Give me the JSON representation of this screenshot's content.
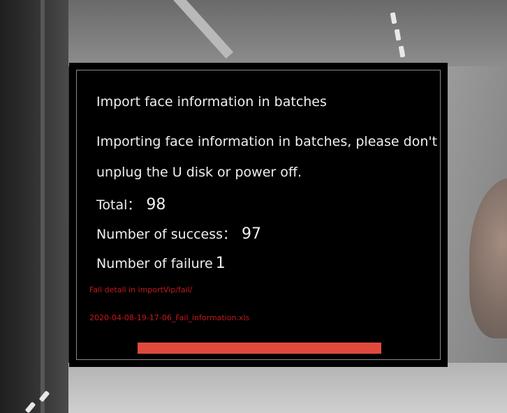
{
  "dialog": {
    "title": "Import face information in batches",
    "message": "Importing face information in batches, please don't unplug the U disk or power off.",
    "total_label": "Total：",
    "total_value": "98",
    "success_label": "Number of success：",
    "success_value": "97",
    "failure_label": "Number of failure",
    "failure_value": "1",
    "fail_detail_line1": "Fail detail in importVip/fail/",
    "fail_detail_line2": "2020-04-08-19-17-06_Fail_information.xls",
    "progress_fraction": 1.0
  },
  "colors": {
    "dialog_background": "#000000",
    "dialog_border": "#8a8a8a",
    "text": "#efefef",
    "fail_text": "#c8191a",
    "progress_fill": "#e04a3c"
  }
}
